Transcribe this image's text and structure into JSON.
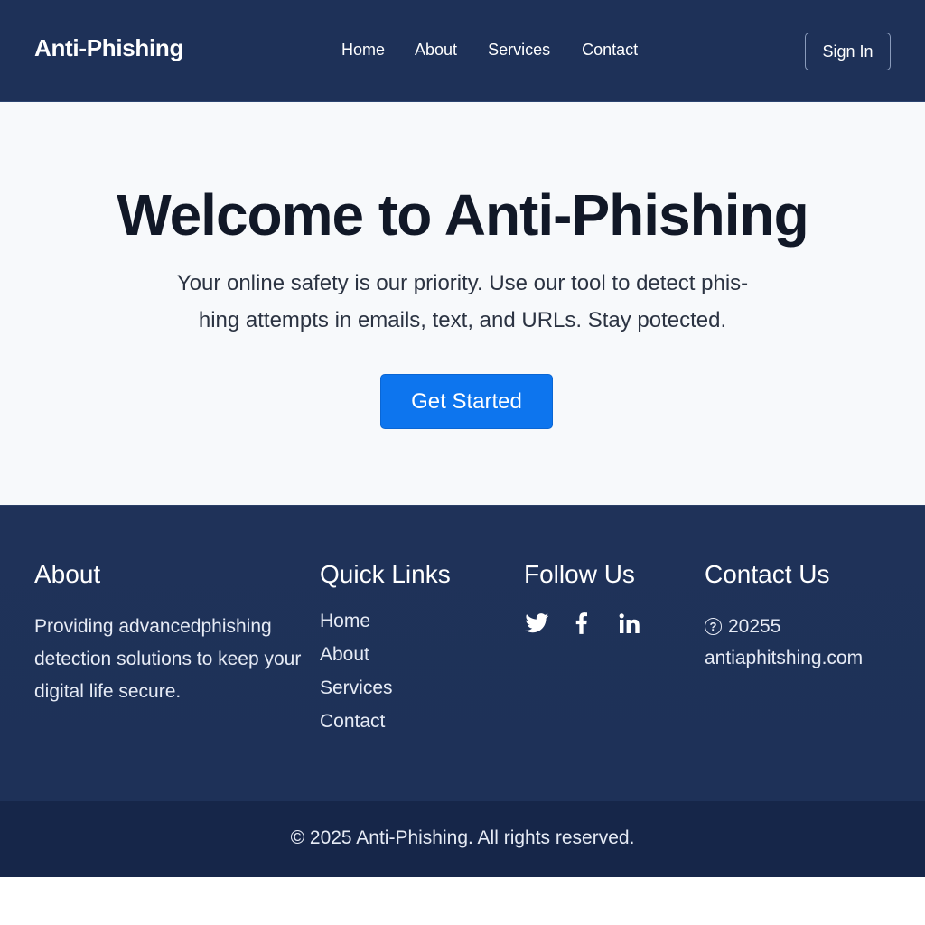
{
  "navbar": {
    "brand": "Anti-Phishing",
    "links": [
      "Home",
      "About",
      "Services",
      "Contact"
    ],
    "signin_label": "Sign In"
  },
  "hero": {
    "title": "Welcome to Anti-Phishing",
    "line1": "Your online safety is our priority. Use our tool to detect phis-",
    "line2": "hing attempts in emails, text, and URLs. Stay potected.",
    "cta_label": "Get Started"
  },
  "footer": {
    "about": {
      "heading": "About",
      "text": "Providing advancedphishing detection solutions to keep your digital life secure."
    },
    "quick_links": {
      "heading": "Quick Links",
      "items": [
        "Home",
        "About",
        "Services",
        "Contact"
      ]
    },
    "follow": {
      "heading": "Follow Us",
      "icons": [
        "twitter-icon",
        "facebook-icon",
        "linkedin-icon"
      ]
    },
    "contact": {
      "heading": "Contact Us",
      "line1": "20255",
      "line2": "antiaphitshing.com",
      "icon": "help-circle-icon"
    }
  },
  "bottom": {
    "copyright": "© 2025 Anti-Phishing. All rights reserved."
  },
  "colors": {
    "nav_bg": "#1e3158",
    "hero_bg": "#f7f9fb",
    "accent": "#0d75ee",
    "bottom_bg": "#162649"
  }
}
